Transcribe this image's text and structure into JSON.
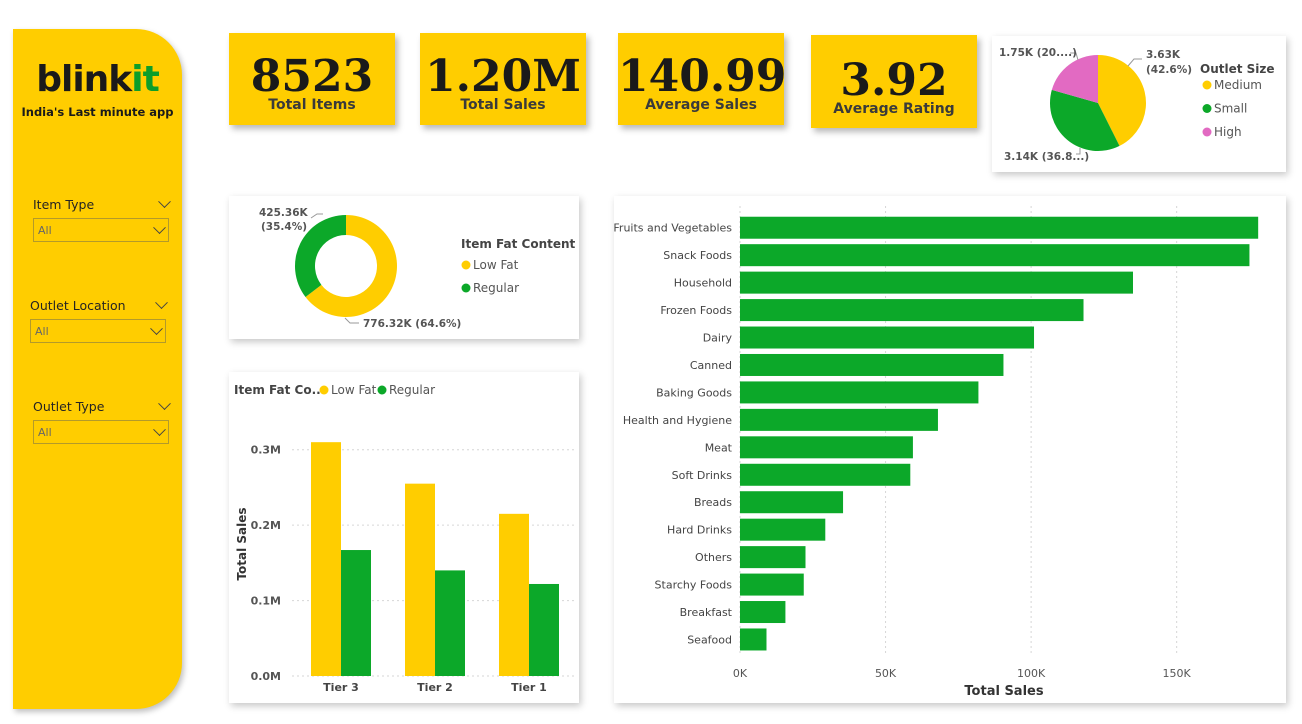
{
  "brand": {
    "name_main": "blink",
    "name_accent": "it",
    "tagline": "India's Last minute app"
  },
  "filters": [
    {
      "label": "Item Type",
      "value": "All"
    },
    {
      "label": "Outlet Location",
      "value": "All"
    },
    {
      "label": "Outlet Type",
      "value": "All"
    }
  ],
  "kpis": [
    {
      "value": "8523",
      "label": "Total Items"
    },
    {
      "value": "1.20M",
      "label": "Total Sales"
    },
    {
      "value": "140.99",
      "label": "Average Sales"
    },
    {
      "value": "3.92",
      "label": "Average Rating"
    }
  ],
  "colors": {
    "yellow": "#FFCD00",
    "green": "#0CA829",
    "pink": "#E26AC2",
    "grid": "#cccccc"
  },
  "chart_data": [
    {
      "type": "pie",
      "legend_title": "Outlet Size",
      "legend_position": "right",
      "slices": [
        {
          "name": "Medium",
          "value": 42.6,
          "label": "3.63K",
          "label2": "(42.6%)",
          "color": "#FFCD00"
        },
        {
          "name": "Small",
          "value": 36.8,
          "label": "3.14K (36.8...)",
          "color": "#0CA829"
        },
        {
          "name": "High",
          "value": 20.6,
          "label": "1.75K (20....)",
          "color": "#E26AC2"
        }
      ]
    },
    {
      "type": "pie",
      "donut": true,
      "legend_title": "Item Fat Content",
      "legend_position": "right",
      "slices": [
        {
          "name": "Low Fat",
          "value": 776.32,
          "label": "776.32K (64.6%)",
          "color": "#FFCD00"
        },
        {
          "name": "Regular",
          "value": 425.36,
          "label": "425.36K",
          "label2": "(35.4%)",
          "color": "#0CA829"
        }
      ]
    },
    {
      "type": "bar",
      "legend_title": "Item Fat Co...",
      "legend_position": "top",
      "categories": [
        "Tier 3",
        "Tier 2",
        "Tier 1"
      ],
      "series": [
        {
          "name": "Low Fat",
          "values": [
            0.31,
            0.255,
            0.215
          ],
          "color": "#FFCD00"
        },
        {
          "name": "Regular",
          "values": [
            0.167,
            0.14,
            0.122
          ],
          "color": "#0CA829"
        }
      ],
      "ylabel": "Total Sales",
      "yticks": [
        "0.0M",
        "0.1M",
        "0.2M",
        "0.3M"
      ],
      "ylim": [
        0,
        0.35
      ],
      "grid": true
    },
    {
      "type": "bar",
      "orientation": "horizontal",
      "categories": [
        "Fruits and Vegetables",
        "Snack Foods",
        "Household",
        "Frozen Foods",
        "Dairy",
        "Canned",
        "Baking Goods",
        "Health and Hygiene",
        "Meat",
        "Soft Drinks",
        "Breads",
        "Hard Drinks",
        "Others",
        "Starchy Foods",
        "Breakfast",
        "Seafood"
      ],
      "values": [
        178,
        175,
        135,
        118,
        101,
        90.5,
        81.9,
        68,
        59.4,
        58.5,
        35.4,
        29.3,
        22.5,
        21.9,
        15.6,
        9.1
      ],
      "xlabel": "Total Sales",
      "xticks": [
        "0K",
        "50K",
        "100K",
        "150K"
      ],
      "xlim": [
        0,
        180
      ],
      "color": "#0CA829",
      "grid": true
    }
  ]
}
